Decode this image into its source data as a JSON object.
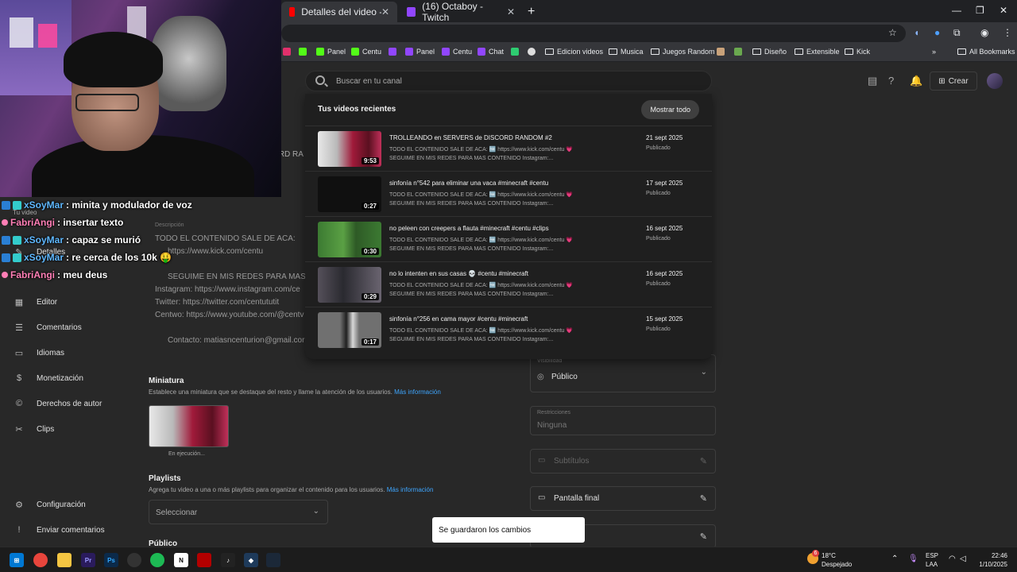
{
  "browser": {
    "tabs": [
      {
        "title": "Detalles del video - YouTube St"
      },
      {
        "title": "(16) Octaboy - Twitch"
      }
    ],
    "bookmarks": [
      {
        "label": "Panel",
        "color": "#53fc18"
      },
      {
        "label": "Centu",
        "color": "#53fc18"
      },
      {
        "label": "Panel",
        "color": "#9146ff"
      },
      {
        "label": "Centu",
        "color": "#9146ff"
      },
      {
        "label": "Chat",
        "color": "#9146ff"
      },
      {
        "label": "Edicion videos",
        "color": "folder"
      },
      {
        "label": "Musica",
        "color": "folder"
      },
      {
        "label": "Juegos Random",
        "color": "folder"
      },
      {
        "label": "Diseño",
        "color": "folder"
      },
      {
        "label": "Extensible",
        "color": "folder"
      },
      {
        "label": "Kick",
        "color": "folder"
      }
    ],
    "all_bookmarks": "All Bookmarks"
  },
  "studio": {
    "search_placeholder": "Buscar en tu canal",
    "create_label": "Crear",
    "sidebar": [
      {
        "label": "Detalles",
        "icon": "pencil-icon"
      },
      {
        "label": "Editor",
        "icon": "film-icon"
      },
      {
        "label": "Comentarios",
        "icon": "comment-icon"
      },
      {
        "label": "Idiomas",
        "icon": "subtitles-icon"
      },
      {
        "label": "Monetización",
        "icon": "dollar-icon"
      },
      {
        "label": "Derechos de autor",
        "icon": "copyright-icon"
      },
      {
        "label": "Clips",
        "icon": "scissors-icon"
      }
    ],
    "sidebar_bottom": [
      {
        "label": "Configuración",
        "icon": "gear-icon"
      },
      {
        "label": "Enviar comentarios",
        "icon": "feedback-icon"
      }
    ],
    "tu_video": "Tu video",
    "partial_title": "ORD RA",
    "description_label": "Descripción",
    "description_lines": [
      "TODO EL CONTENIDO SALE DE ACA:",
      "https://www.kick.com/centu",
      "SEGUIME EN MIS REDES PARA MAS CO",
      "Instagram: https://www.instagram.com/ce",
      "Twitter: https://twitter.com/centututit",
      "Centwo: https://www.youtube.com/@centv",
      "Contacto: matiasncenturion@gmail.cor"
    ],
    "thumbnail_title": "Miniatura",
    "thumbnail_sub": "Establece una miniatura que se destaque del resto y llame la atención de los usuarios.",
    "thumbnail_link": "Más información",
    "thumbnail_status": "En ejecución...",
    "playlists_title": "Playlists",
    "playlists_sub": "Agrega tu video a una o más playlists para organizar el contenido para los usuarios.",
    "playlists_link": "Más información",
    "playlists_select": "Seleccionar",
    "audience_title": "Público",
    "right_fields": {
      "visibility_label": "Visibilidad",
      "visibility_value": "Público",
      "restrictions_label": "Restricciones",
      "restrictions_value": "Ninguna",
      "subtitles": "Subtítulos",
      "end_screen": "Pantalla final"
    }
  },
  "dropdown": {
    "title": "Tus videos recientes",
    "show_all": "Mostrar todo",
    "videos": [
      {
        "title": "TROLLEANDO en SERVERS de DISCORD RANDOM #2",
        "desc1": "TODO EL CONTENIDO SALE DE ACA: 🆓 https://www.kick.com/centu 💗",
        "desc2": "SEGUIME EN MIS REDES PARA MAS CONTENIDO Instagram:...",
        "date": "21 sept 2025",
        "status": "Publicado",
        "duration": "9:53",
        "thumb": "linear-gradient(90deg,#e8e8e8 0%,#b9b9b9 30%,#a01a3a 55%,#5a1020 80%,#c0305a 100%)"
      },
      {
        "title": "sinfonía n°542 para eliminar una vaca #minecraft #centu",
        "desc1": "TODO EL CONTENIDO SALE DE ACA: 🆓 https://www.kick.com/centu 💗",
        "desc2": "SEGUIME EN MIS REDES PARA MAS CONTENIDO Instagram:...",
        "date": "17 sept 2025",
        "status": "Publicado",
        "duration": "0:27",
        "thumb": "#101010"
      },
      {
        "title": "no peleen con creepers a flauta #minecraft #centu #clips",
        "desc1": "TODO EL CONTENIDO SALE DE ACA: 🆓 https://www.kick.com/centu 💗",
        "desc2": "SEGUIME EN MIS REDES PARA MAS CONTENIDO Instagram:...",
        "date": "16 sept 2025",
        "status": "Publicado",
        "duration": "0:30",
        "thumb": "linear-gradient(90deg,#3c7a32 0%,#5aa044 40%,#2e5a26 60%,#3c7a32 100%)"
      },
      {
        "title": "no lo intenten en sus casas 💀 #centu #minecraft",
        "desc1": "TODO EL CONTENIDO SALE DE ACA: 🆓 https://www.kick.com/centu 💗",
        "desc2": "SEGUIME EN MIS REDES PARA MAS CONTENIDO Instagram:...",
        "date": "16 sept 2025",
        "status": "Publicado",
        "duration": "0:29",
        "thumb": "linear-gradient(90deg,#55505a 0%,#2a2a30 40%,#6a6470 100%)"
      },
      {
        "title": "sinfonía n°256 en cama mayor #centu #minecraft",
        "desc1": "TODO EL CONTENIDO SALE DE ACA: 🆓 https://www.kick.com/centu 💗",
        "desc2": "SEGUIME EN MIS REDES PARA MAS CONTENIDO Instagram:...",
        "date": "15 sept 2025",
        "status": "Publicado",
        "duration": "0:17",
        "thumb": "linear-gradient(90deg,#707070 0%,#707070 35%,#202020 45%,#d8d8d8 55%,#707070 65%,#707070 100%)"
      }
    ]
  },
  "chat": [
    {
      "user": "xSoyMar",
      "msg": ": minita y modulador de voz",
      "color": "blue"
    },
    {
      "user": "FabriAngi",
      "msg": ": insertar texto",
      "color": "pink"
    },
    {
      "user": "xSoyMar",
      "msg": ": capaz se murió",
      "color": "blue"
    },
    {
      "user": "xSoyMar",
      "msg": ": re cerca de los 10k 🤑",
      "color": "blue"
    },
    {
      "user": "FabriAngi",
      "msg": ": meu deus",
      "color": "pink"
    }
  ],
  "toast": "Se guardaron los cambios",
  "taskbar": {
    "weather_temp": "18°C",
    "weather_desc": "Despejado",
    "weather_badge": "6",
    "lang1": "ESP",
    "lang2": "LAA",
    "time": "22:46",
    "date": "1/10/2025"
  }
}
